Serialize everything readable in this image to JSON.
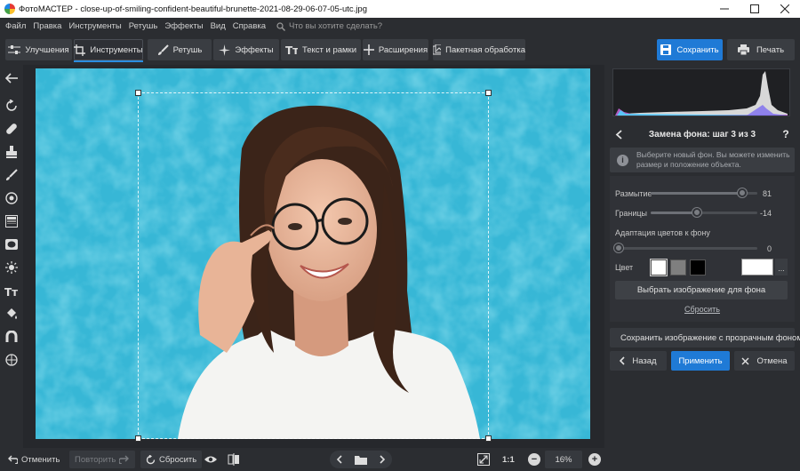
{
  "window": {
    "title": "ФотоМАСТЕР - close-up-of-smiling-confident-beautiful-brunette-2021-08-29-06-07-05-utc.jpg",
    "minimize_icon": "minimize-icon",
    "maximize_icon": "maximize-icon",
    "close_icon": "close-icon"
  },
  "menu": {
    "items": [
      "Файл",
      "Правка",
      "Инструменты",
      "Ретушь",
      "Эффекты",
      "Вид",
      "Справка"
    ],
    "search_placeholder": "Что вы хотите сделать?"
  },
  "toolbar": {
    "tabs": [
      {
        "label": "Улучшения",
        "icon": "sliders-icon",
        "active": false
      },
      {
        "label": "Инструменты",
        "icon": "crop-icon",
        "active": true
      },
      {
        "label": "Ретушь",
        "icon": "brush-icon",
        "active": false
      },
      {
        "label": "Эффекты",
        "icon": "sparkle-icon",
        "active": false
      },
      {
        "label": "Текст и рамки",
        "icon": "text-icon",
        "active": false
      },
      {
        "label": "Расширения",
        "icon": "plus-icon",
        "active": false
      },
      {
        "label": "Пакетная обработка",
        "icon": "batch-icon",
        "active": false
      }
    ],
    "save_label": "Сохранить",
    "print_label": "Печать"
  },
  "left_tools": [
    "back-arrow-icon",
    "rotate-icon",
    "healing-icon",
    "stamp-icon",
    "brush-icon",
    "radial-filter-icon",
    "gradient-filter-icon",
    "vignette-icon",
    "light-icon",
    "text-icon",
    "fill-icon",
    "magnet-icon",
    "globe-icon"
  ],
  "bottom": {
    "undo_label": "Отменить",
    "redo_label": "Повторить",
    "reset_label": "Сбросить",
    "zoom_fit_label": "1:1",
    "zoom_value": "16%"
  },
  "panel": {
    "title": "Замена фона: шаг 3 из 3",
    "help": "?",
    "info_text": "Выберите новый фон. Вы можете изменить размер и положение объекта.",
    "sliders": [
      {
        "label": "Размытие",
        "value": "81",
        "level": 0.86
      },
      {
        "label": "Границы",
        "value": "-14",
        "level": 0.43
      },
      {
        "label": "Адаптация цветов к фону",
        "value": "0",
        "level": 0.0
      }
    ],
    "color_label": "Цвет",
    "swatches": [
      "#ffffff",
      "#7f7f7f",
      "#000000"
    ],
    "custom_color": "#ffffff",
    "more_label": "...",
    "choose_image_label": "Выбрать изображение для фона",
    "reset_link": "Сбросить",
    "save_transparent_label": "Сохранить изображение с прозрачным фоном",
    "back_label": "Назад",
    "apply_label": "Применить",
    "cancel_label": "Отмена"
  },
  "colors": {
    "accent": "#1f7ad6",
    "background": "#2b2d31",
    "photo_background": "#39b9d8"
  }
}
